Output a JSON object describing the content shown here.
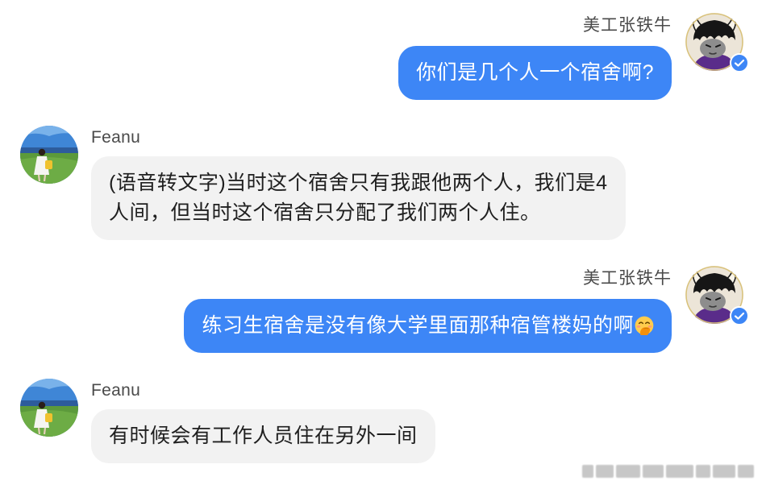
{
  "theme": {
    "outgoing_bubble": "#3D86F6",
    "incoming_bubble": "#F2F2F2",
    "name_color": "#4A4A4A",
    "text_color": "#1F1F1F"
  },
  "messages": [
    {
      "direction": "outgoing",
      "sender": "美工张铁牛",
      "avatar_icon": "bull-cartoon-avatar-icon",
      "verified": true,
      "text": "你们是几个人一个宿舍啊?"
    },
    {
      "direction": "incoming",
      "sender": "Feanu",
      "avatar_icon": "field-photo-avatar-icon",
      "lines": [
        "(语音转文字)当时这个宿舍只有我跟他两个人，我们是4",
        "人间，但当时这个宿舍只分配了我们两个人住。"
      ]
    },
    {
      "direction": "outgoing",
      "sender": "美工张铁牛",
      "avatar_icon": "bull-cartoon-avatar-icon",
      "verified": true,
      "text": "练习生宿舍是没有像大学里面那种宿管楼妈的啊",
      "emoji_icon": "hand-over-mouth-emoji-icon"
    },
    {
      "direction": "incoming",
      "sender": "Feanu",
      "avatar_icon": "field-photo-avatar-icon",
      "text": "有时候会有工作人员住在另外一间"
    }
  ]
}
